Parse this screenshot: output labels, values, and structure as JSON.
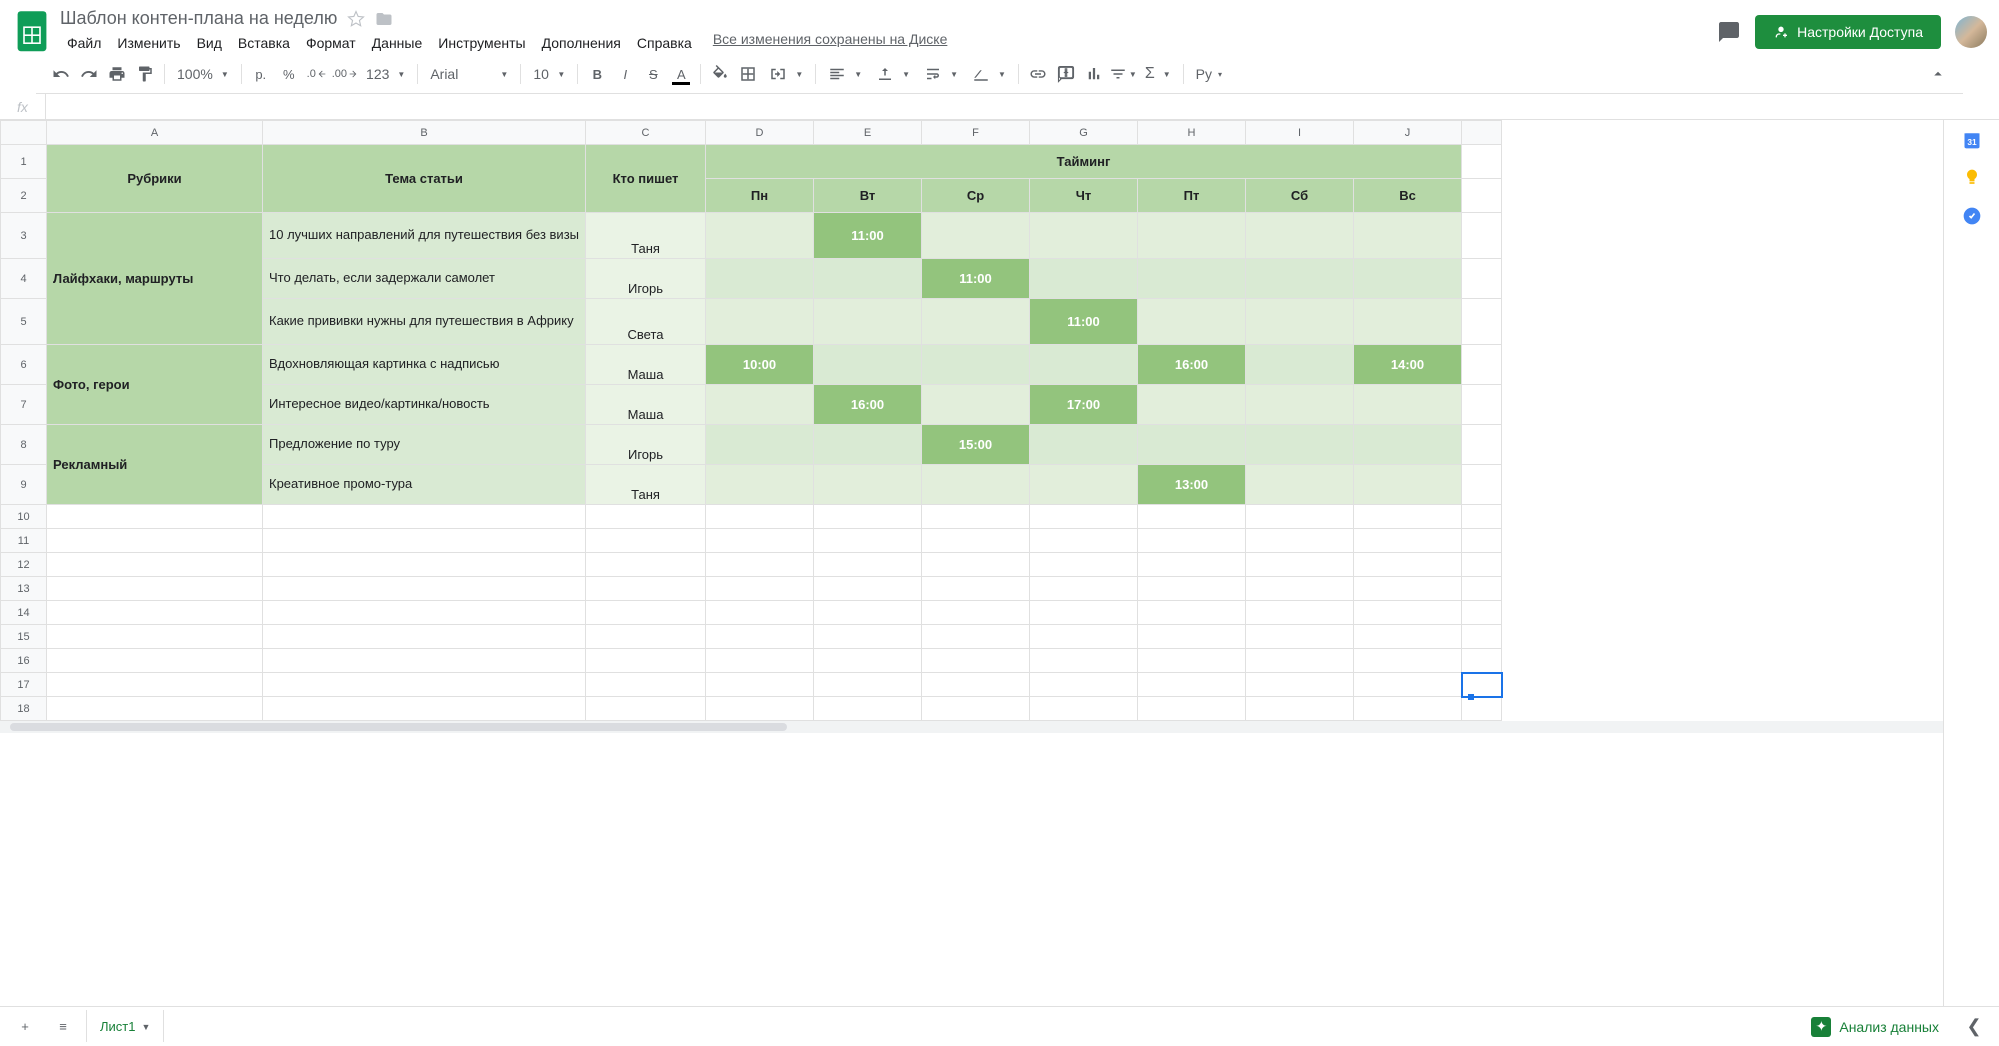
{
  "doc_title": "Шаблон контен-плана на неделю",
  "menu": [
    "Файл",
    "Изменить",
    "Вид",
    "Вставка",
    "Формат",
    "Данные",
    "Инструменты",
    "Дополнения",
    "Справка"
  ],
  "save_status": "Все изменения сохранены на Диске",
  "share_label": "Настройки Доступа",
  "toolbar": {
    "zoom": "100%",
    "currency": "р.",
    "percent": "%",
    "dec_less": ".0",
    "dec_more": ".00",
    "format_more": "123",
    "font": "Arial",
    "size": "10",
    "input_lang": "Ру"
  },
  "formula_label": "fx",
  "columns": [
    "A",
    "B",
    "C",
    "D",
    "E",
    "F",
    "G",
    "H",
    "I",
    "J"
  ],
  "row_count": 18,
  "headers": {
    "rubriki": "Рубрики",
    "tema": "Тема статьи",
    "kto": "Кто пишет",
    "timing": "Тайминг",
    "days": [
      "Пн",
      "Вт",
      "Ср",
      "Чт",
      "Пт",
      "Сб",
      "Вс"
    ]
  },
  "rows": [
    {
      "cat": "Лайфхаки, маршруты",
      "cat_span": 3,
      "topic": "10 лучших направлений для путешествия без визы",
      "who": "Таня",
      "times": [
        "",
        "11:00",
        "",
        "",
        "",
        "",
        ""
      ],
      "alt": 0
    },
    {
      "topic": "Что делать, если задержали самолет",
      "who": "Игорь",
      "times": [
        "",
        "",
        "11:00",
        "",
        "",
        "",
        ""
      ],
      "alt": 1
    },
    {
      "topic": "Какие прививки нужны для путешествия в Африку",
      "who": "Света",
      "times": [
        "",
        "",
        "",
        "11:00",
        "",
        "",
        ""
      ],
      "alt": 0
    },
    {
      "cat": "Фото, герои",
      "cat_span": 2,
      "topic": "Вдохновляющая картинка с надписью",
      "who": "Маша",
      "times": [
        "10:00",
        "",
        "",
        "",
        "16:00",
        "",
        "14:00"
      ],
      "alt": 1
    },
    {
      "topic": "Интересное видео/картинка/новость",
      "who": "Маша",
      "times": [
        "",
        "16:00",
        "",
        "17:00",
        "",
        "",
        ""
      ],
      "alt": 0
    },
    {
      "cat": "Рекламный",
      "cat_span": 2,
      "topic": "Предложение по туру",
      "who": "Игорь",
      "times": [
        "",
        "",
        "15:00",
        "",
        "",
        "",
        ""
      ],
      "alt": 1
    },
    {
      "topic": "Креативное промо-тура",
      "who": "Таня",
      "times": [
        "",
        "",
        "",
        "",
        "13:00",
        "",
        ""
      ],
      "alt": 0
    }
  ],
  "sheet_tab": "Лист1",
  "analyze_label": "Анализ данных",
  "selected_row": 17
}
